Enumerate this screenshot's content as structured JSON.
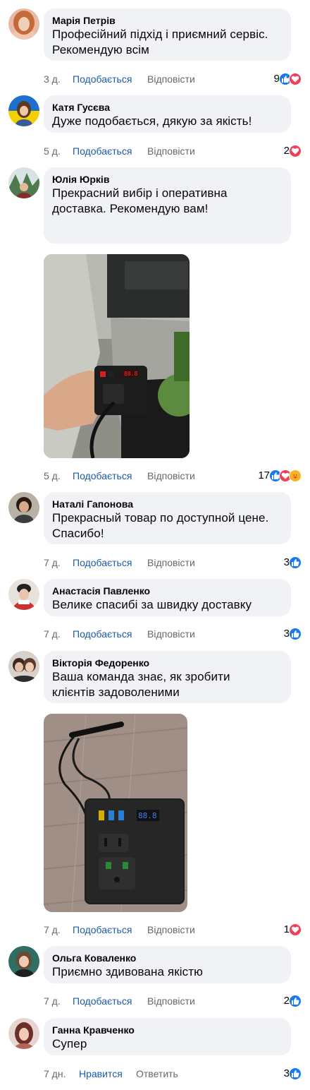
{
  "comments": [
    {
      "name": "Марія Петрів",
      "lines": [
        "Професійний підхід і приємний сервіс.",
        "Рекомендую всім"
      ],
      "time": "3 д.",
      "like": "Подобається",
      "reply": "Відповісти",
      "count": "9",
      "reactions": [
        "like-icon",
        "love-icon"
      ]
    },
    {
      "name": "Катя Гусєва",
      "lines": [
        "Дуже подобається, дякую за якість!"
      ],
      "time": "5 д.",
      "like": "Подобається",
      "reply": "Відповісти",
      "count": "2",
      "reactions": [
        "love-icon"
      ]
    },
    {
      "name": "Юлія Юрків",
      "lines": [
        "Прекрасний вибір і оперативна",
        "доставка. Рекомендую вам!"
      ],
      "time": "5 д.",
      "like": "Подобається",
      "reply": "Відповісти",
      "count": "17",
      "reactions": [
        "like-icon",
        "love-icon",
        "care-icon"
      ]
    },
    {
      "name": "Наталі Гапонова",
      "lines": [
        "Прекрасный товар по доступной цене.",
        "Спасибо!"
      ],
      "time": "7 д.",
      "like": "Подобається",
      "reply": "Відповісти",
      "count": "3",
      "reactions": [
        "like-icon"
      ]
    },
    {
      "name": "Анастасія Павленко",
      "lines": [
        "Велике спасибі за швидку доставку"
      ],
      "time": "7 д.",
      "like": "Подобається",
      "reply": "Відповісти",
      "count": "3",
      "reactions": [
        "like-icon"
      ]
    },
    {
      "name": "Вікторія Федоренко",
      "lines": [
        "Ваша команда знає, як зробити",
        "клієнтів задоволеними"
      ],
      "time": "7 д.",
      "like": "Подобається",
      "reply": "Відповісти",
      "count": "1",
      "reactions": [
        "love-icon"
      ]
    },
    {
      "name": "Ольга Коваленко",
      "lines": [
        "Приємно здивована якістю"
      ],
      "time": "7 д.",
      "like": "Подобається",
      "reply": "Відповісти",
      "count": "2",
      "reactions": [
        "like-icon"
      ]
    },
    {
      "name": "Ганна Кравченко",
      "lines": [
        "Супер"
      ],
      "time": "7 дн.",
      "like": "Нравится",
      "reply": "Ответить",
      "count": "3",
      "reactions": [
        "like-icon"
      ]
    }
  ],
  "photos": {
    "photo_1": {
      "display": "88.8",
      "subject": "inverter-in-car-photo"
    },
    "photo_2": {
      "display": "88.8",
      "subject": "inverter-on-floor-photo"
    }
  },
  "colors": {
    "link": "#1a5cad",
    "muted": "#65676b",
    "bubble": "#f0f2f5",
    "like": "#1877f2",
    "love": "#f33e58",
    "care": "#f7b125"
  }
}
